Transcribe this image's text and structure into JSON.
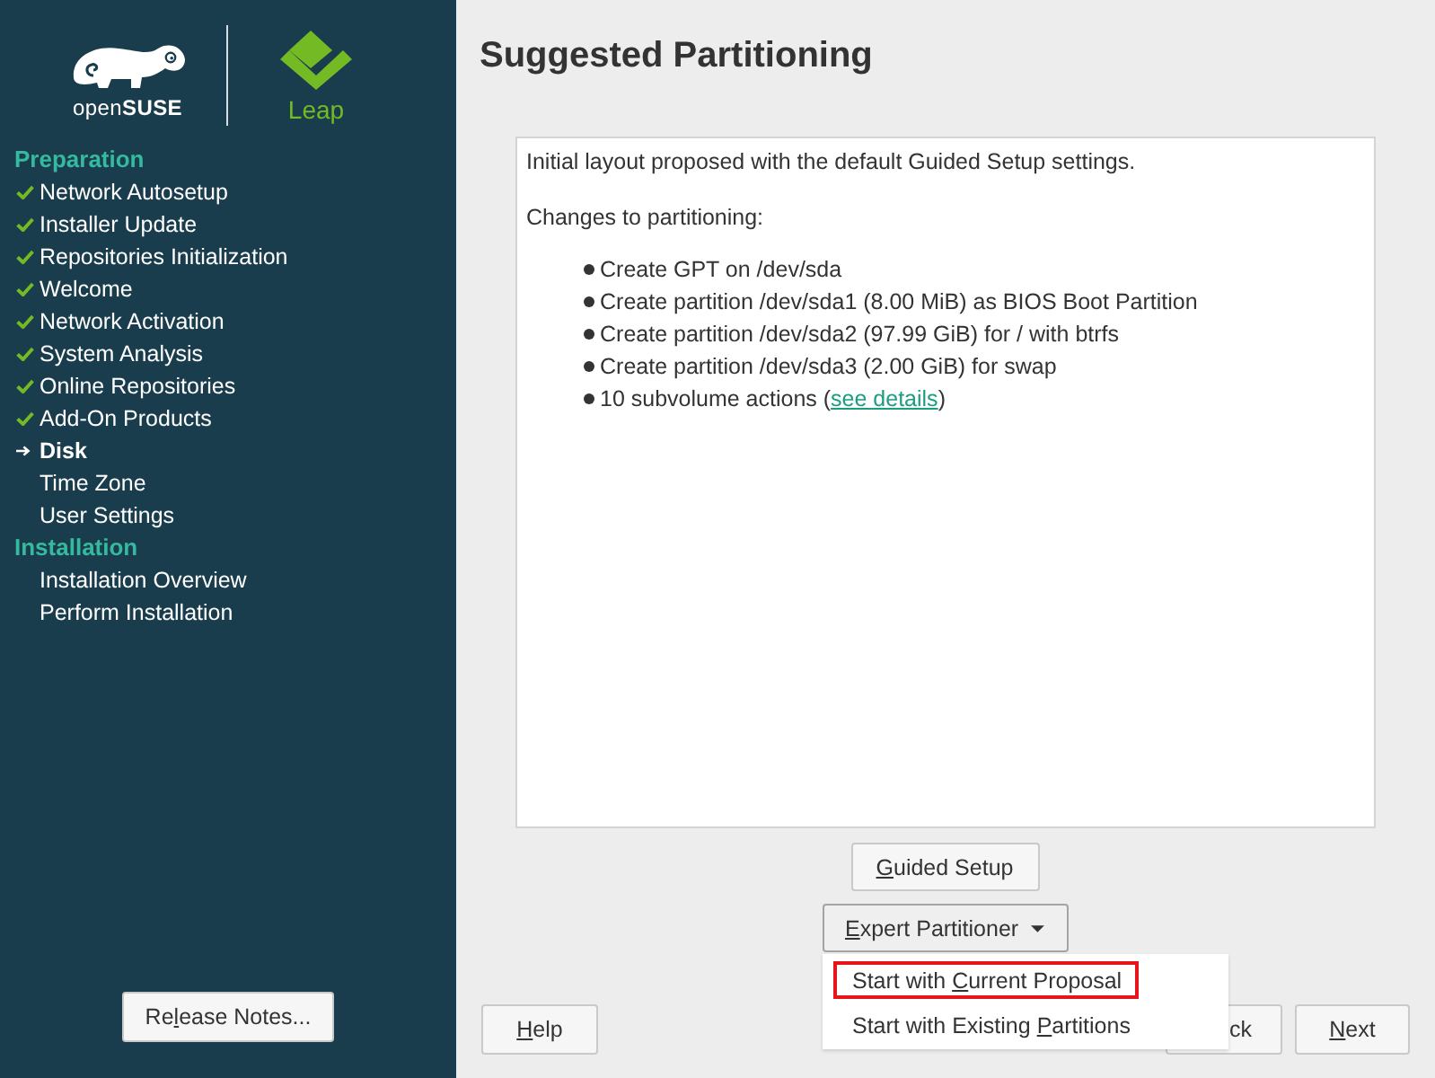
{
  "sidebar": {
    "logo": {
      "wordmark": "open**SUSE**",
      "product": "Leap"
    },
    "sections": [
      {
        "title": "Preparation",
        "steps": [
          {
            "label": "Network Autosetup",
            "completed": true,
            "current": false
          },
          {
            "label": "Installer Update",
            "completed": true,
            "current": false
          },
          {
            "label": "Repositories Initialization",
            "completed": true,
            "current": false
          },
          {
            "label": "Welcome",
            "completed": true,
            "current": false
          },
          {
            "label": "Network Activation",
            "completed": true,
            "current": false
          },
          {
            "label": "System Analysis",
            "completed": true,
            "current": false
          },
          {
            "label": "Online Repositories",
            "completed": true,
            "current": false
          },
          {
            "label": "Add-On Products",
            "completed": true,
            "current": false
          },
          {
            "label": "Disk",
            "completed": false,
            "current": true
          },
          {
            "label": "Time Zone",
            "completed": false,
            "current": false
          },
          {
            "label": "User Settings",
            "completed": false,
            "current": false
          }
        ]
      },
      {
        "title": "Installation",
        "steps": [
          {
            "label": "Installation Overview",
            "completed": false,
            "current": false
          },
          {
            "label": "Perform Installation",
            "completed": false,
            "current": false
          }
        ]
      }
    ],
    "release_notes_button": {
      "label_start": "Re",
      "mnemonic": "l",
      "label_end": "ease Notes..."
    }
  },
  "title": "Suggested Partitioning",
  "summary": {
    "intro": "Initial layout proposed with the default Guided Setup settings.",
    "changes_heading": "Changes to partitioning:",
    "changes": [
      {
        "text": "Create GPT on /dev/sda"
      },
      {
        "text": "Create partition /dev/sda1 (8.00 MiB) as BIOS Boot Partition"
      },
      {
        "text": "Create partition /dev/sda2 (97.99 GiB) for / with btrfs"
      },
      {
        "text": "Create partition /dev/sda3 (2.00 GiB) for swap"
      },
      {
        "text": "10 subvolume actions (",
        "link": "see details",
        "text_after": ")"
      }
    ]
  },
  "guided_setup_button": {
    "mnemonic": "G",
    "label_end": "uided Setup"
  },
  "expert_partitioner": {
    "button": {
      "mnemonic": "E",
      "label_end": "xpert Partitioner"
    },
    "expanded": true,
    "menu": [
      {
        "label_start": "Start with ",
        "mnemonic": "C",
        "label_end": "urrent Proposal",
        "selected": true
      },
      {
        "label_start": "Start with Existing ",
        "mnemonic": "P",
        "label_end": "artitions",
        "selected": false
      }
    ]
  },
  "footer": {
    "help_button": {
      "mnemonic": "H",
      "label_end": "elp"
    },
    "back_button": {
      "label_end": "ck"
    },
    "next_button": {
      "mnemonic": "N",
      "label_end": "ext"
    }
  }
}
